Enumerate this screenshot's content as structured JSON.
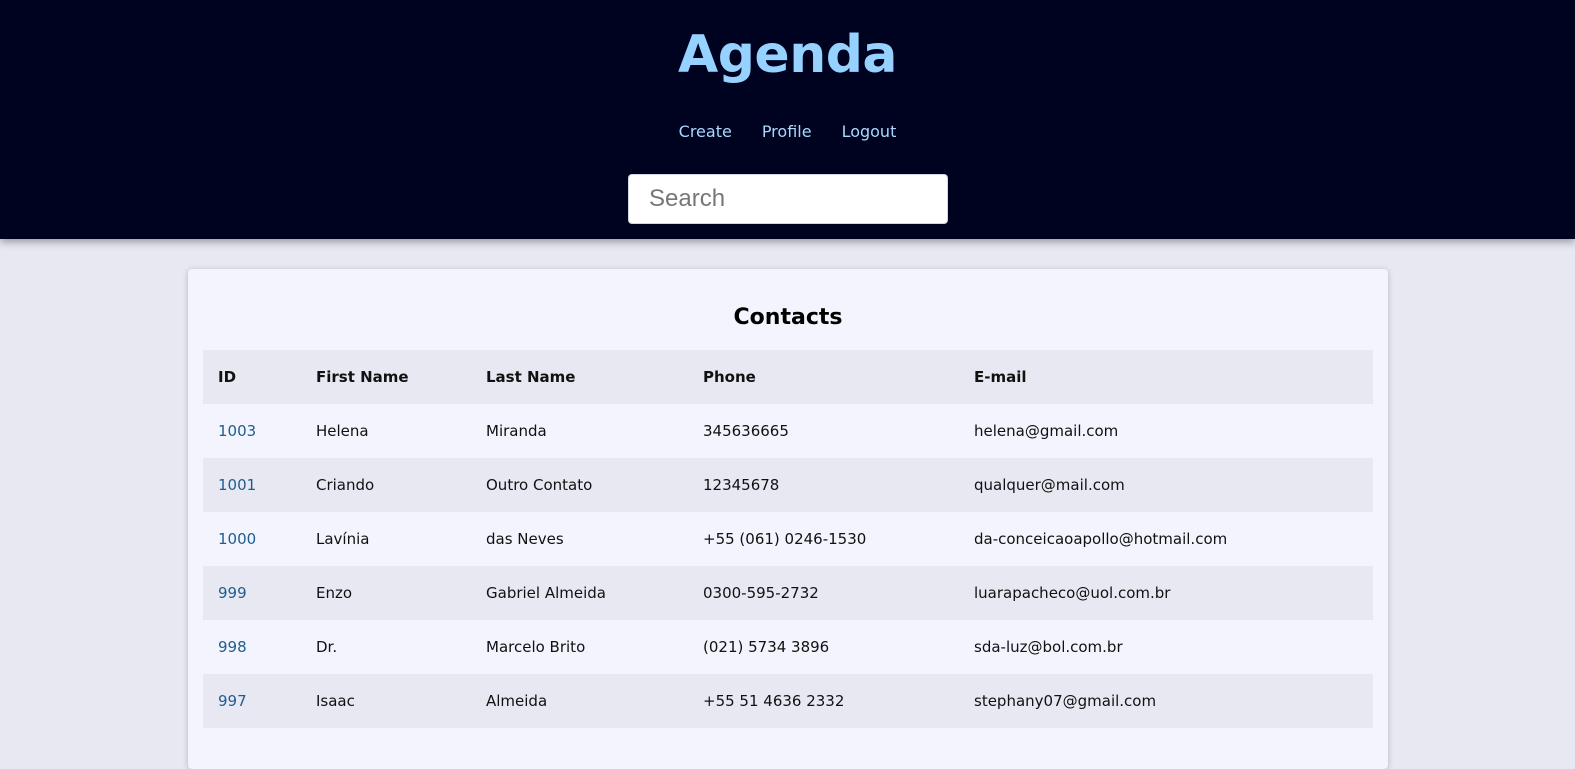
{
  "header": {
    "title": "Agenda",
    "nav": [
      {
        "label": "Create"
      },
      {
        "label": "Profile"
      },
      {
        "label": "Logout"
      }
    ],
    "search": {
      "placeholder": "Search",
      "value": ""
    }
  },
  "contacts": {
    "title": "Contacts",
    "columns": [
      "ID",
      "First Name",
      "Last Name",
      "Phone",
      "E-mail"
    ],
    "rows": [
      {
        "id": "1003",
        "first": "Helena",
        "last": "Miranda",
        "phone": "345636665",
        "email": "helena@gmail.com"
      },
      {
        "id": "1001",
        "first": "Criando",
        "last": "Outro Contato",
        "phone": "12345678",
        "email": "qualquer@mail.com"
      },
      {
        "id": "1000",
        "first": "Lavínia",
        "last": "das Neves",
        "phone": "+55 (061) 0246-1530",
        "email": "da-conceicaoapollo@hotmail.com"
      },
      {
        "id": "999",
        "first": "Enzo",
        "last": "Gabriel Almeida",
        "phone": "0300-595-2732",
        "email": "luarapacheco@uol.com.br"
      },
      {
        "id": "998",
        "first": "Dr.",
        "last": "Marcelo Brito",
        "phone": "(021) 5734 3896",
        "email": "sda-luz@bol.com.br"
      },
      {
        "id": "997",
        "first": "Isaac",
        "last": "Almeida",
        "phone": "+55 51 4636 2332",
        "email": "stephany07@gmail.com"
      }
    ]
  },
  "colors": {
    "header_bg": "#000320",
    "title": "#96d2ff",
    "nav_link": "#a8d8ff",
    "id_link": "#1f5c8f",
    "page_bg": "#e8e8f3",
    "card_bg": "#f3f4fd"
  }
}
